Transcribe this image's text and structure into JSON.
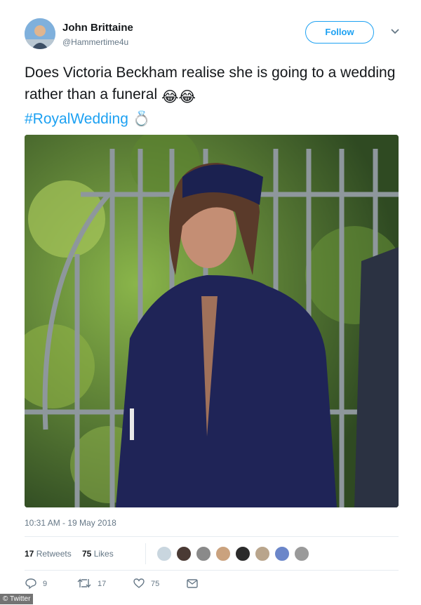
{
  "author": {
    "name": "John Brittaine",
    "handle": "@Hammertime4u"
  },
  "follow_label": "Follow",
  "tweet": {
    "text": "Does Victoria Beckham realise she is going to a wedding rather than a funeral",
    "emojis": "😂😂",
    "hashtag": "#RoyalWedding",
    "hashtag_emoji": "💍"
  },
  "timestamp": "10:31 AM - 19 May 2018",
  "stats": {
    "retweets_count": "17",
    "retweets_label": "Retweets",
    "likes_count": "75",
    "likes_label": "Likes"
  },
  "actions": {
    "replies": "9",
    "retweets": "17",
    "likes": "75"
  },
  "liker_avatars": [
    "#c9d6df",
    "#4a3a34",
    "#8a8a8a",
    "#caa27e",
    "#2b2b2b",
    "#b9a58c",
    "#6b86c9",
    "#9a9a9a"
  ],
  "photo_credit": "© Twitter",
  "icons": {
    "reply": "reply-icon",
    "retweet": "retweet-icon",
    "like": "heart-icon",
    "message": "envelope-icon",
    "chevron": "chevron-down-icon",
    "ring": "ring-icon"
  },
  "colors": {
    "accent": "#1da1f2",
    "text": "#14171a",
    "muted": "#657786",
    "divider": "#e6ecf0"
  }
}
